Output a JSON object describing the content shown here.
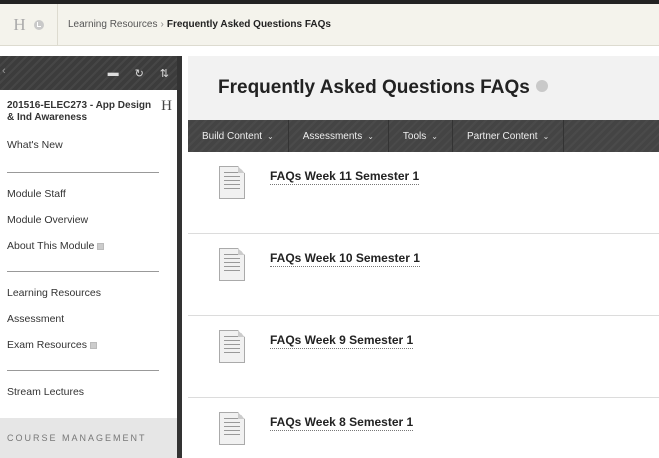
{
  "breadcrumb": {
    "home_glyph": "H",
    "link": "Learning Resources",
    "separator": "›",
    "current": "Frequently Asked Questions FAQs"
  },
  "sidebar": {
    "toolbar_icons": [
      "left-arrow-icon",
      "folder-icon",
      "refresh-icon",
      "sort-icon"
    ],
    "toolbar_glyphs": {
      "left_arrow": "‹",
      "folder": "▬",
      "refresh": "↻",
      "sort": "⇅"
    },
    "course_name": "201516-ELEC273 - App Design & Ind Awareness",
    "course_h": "H",
    "groups": [
      [
        "What's New"
      ],
      [
        "Module Staff",
        "Module Overview",
        "About This Module"
      ],
      [
        "Learning Resources",
        "Assessment",
        "Exam Resources"
      ],
      [
        "Stream Lectures"
      ]
    ],
    "course_management": "COURSE MANAGEMENT"
  },
  "main": {
    "title": "Frequently Asked Questions FAQs",
    "actions": [
      "Build Content",
      "Assessments",
      "Tools",
      "Partner Content"
    ],
    "action_caret": "⌄",
    "items": [
      {
        "title": "FAQs Week 11 Semester 1",
        "icon": "document-icon"
      },
      {
        "title": "FAQs Week 10 Semester 1",
        "icon": "document-icon"
      },
      {
        "title": "FAQs Week 9 Semester 1",
        "icon": "document-icon"
      },
      {
        "title": "FAQs Week 8 Semester 1",
        "icon": "document-icon"
      }
    ]
  },
  "colors": {
    "action_bar": "#444444",
    "sidebar_toolbar": "#3c3c3c",
    "title_bar_bg": "#f2f2f2",
    "breadcrumb_bg": "#f4f3ec"
  }
}
